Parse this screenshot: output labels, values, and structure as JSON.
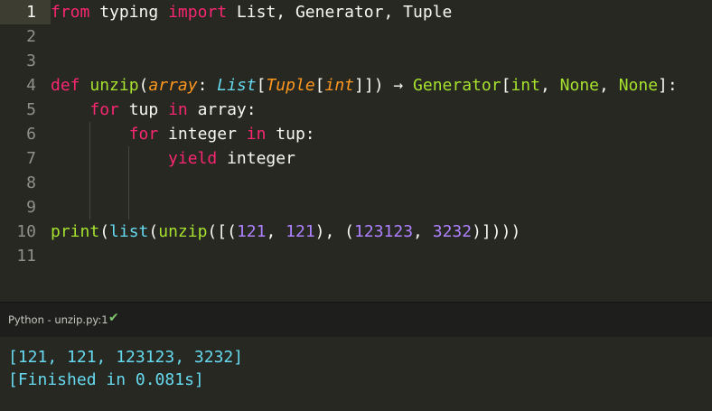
{
  "editor": {
    "line_numbers": [
      "1",
      "2",
      "3",
      "4",
      "5",
      "6",
      "7",
      "8",
      "9",
      "10",
      "11"
    ],
    "line1": {
      "kw_from": "from",
      "mod": " typing ",
      "kw_import": "import",
      "names": " List, Generator, Tuple"
    },
    "line4": {
      "kw_def": "def",
      "sp": " ",
      "fn": "unzip",
      "open": "(",
      "param": "array",
      "colon": ": ",
      "type_list": "List",
      "br1": "[",
      "type_tuple": "Tuple",
      "br2": "[",
      "type_int": "int",
      "close": "]])",
      "arrow": " → ",
      "gen": "Generator",
      "br3": "[",
      "int2": "int",
      "c1": ", ",
      "none1": "None",
      "c2": ", ",
      "none2": "None",
      "end": "]:"
    },
    "line5": {
      "indent": "    ",
      "kw_for": "for",
      "mid": " tup ",
      "kw_in": "in",
      "rest": " array:"
    },
    "line6": {
      "indent": "        ",
      "kw_for": "for",
      "mid": " integer ",
      "kw_in": "in",
      "rest": " tup:"
    },
    "line7": {
      "indent": "            ",
      "kw_yield": "yield",
      "rest": " integer"
    },
    "line10": {
      "print": "print",
      "p1": "(",
      "list": "list",
      "p2": "(",
      "unzip": "unzip",
      "p3": "([(",
      "n1": "121",
      "c1": ", ",
      "n2": "121",
      "p4": "), (",
      "n3": "123123",
      "c2": ", ",
      "n4": "3232",
      "p5": ")])))"
    }
  },
  "status": {
    "text": "Python - unzip.py:1",
    "check_icon": "✔"
  },
  "output": {
    "line1": "[121, 121, 123123, 3232]",
    "line2": "[Finished in 0.081s]"
  }
}
